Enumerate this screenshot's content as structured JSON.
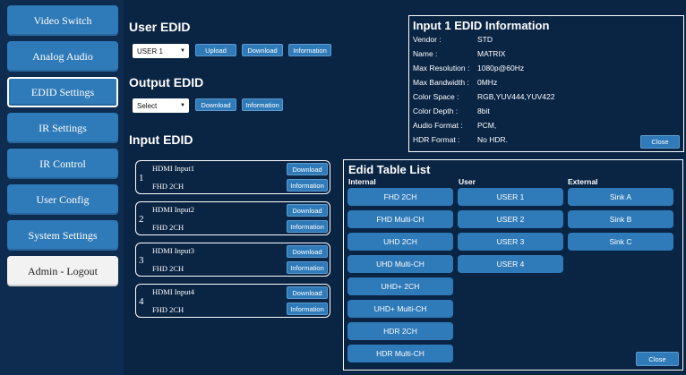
{
  "sidebar": {
    "items": [
      {
        "label": "Video Switch"
      },
      {
        "label": "Analog Audio"
      },
      {
        "label": "EDID Settings"
      },
      {
        "label": "IR Settings"
      },
      {
        "label": "IR Control"
      },
      {
        "label": "User Config"
      },
      {
        "label": "System Settings"
      },
      {
        "label": "Admin - Logout"
      }
    ]
  },
  "user_edid": {
    "title": "User EDID",
    "select_value": "USER 1",
    "upload_label": "Upload",
    "download_label": "Download",
    "information_label": "Information"
  },
  "output_edid": {
    "title": "Output EDID",
    "select_value": "Select",
    "download_label": "Download",
    "information_label": "Information"
  },
  "input_edid": {
    "title": "Input EDID",
    "inputs": [
      {
        "num": "1",
        "name": "HDMI Input1",
        "format": "FHD 2CH",
        "download_label": "Download",
        "information_label": "Information"
      },
      {
        "num": "2",
        "name": "HDMI Input2",
        "format": "FHD 2CH",
        "download_label": "Download",
        "information_label": "Information"
      },
      {
        "num": "3",
        "name": "HDMI Input3",
        "format": "FHD 2CH",
        "download_label": "Download",
        "information_label": "Information"
      },
      {
        "num": "4",
        "name": "HDMI Input4",
        "format": "FHD 2CH",
        "download_label": "Download",
        "information_label": "Information"
      }
    ]
  },
  "info_panel": {
    "title": "Input 1 EDID Information",
    "rows": [
      {
        "label": "Vendor :",
        "value": "STD"
      },
      {
        "label": "Name :",
        "value": "MATRIX"
      },
      {
        "label": "Max Resolution :",
        "value": "1080p@60Hz"
      },
      {
        "label": "Max Bandwidth :",
        "value": "0MHz"
      },
      {
        "label": "Color Space :",
        "value": "RGB,YUV444,YUV422"
      },
      {
        "label": "Color Depth :",
        "value": "8bit"
      },
      {
        "label": "Audio Format :",
        "value": "PCM,"
      },
      {
        "label": "HDR Format :",
        "value": "No HDR."
      }
    ],
    "close_label": "Close"
  },
  "edid_table": {
    "title": "Edid Table List",
    "columns": {
      "internal": {
        "header": "Internal",
        "items": [
          "FHD 2CH",
          "FHD Multi-CH",
          "UHD 2CH",
          "UHD Multi-CH",
          "UHD+ 2CH",
          "UHD+ Multi-CH",
          "HDR 2CH",
          "HDR Multi-CH"
        ]
      },
      "user": {
        "header": "User",
        "items": [
          "USER 1",
          "USER 2",
          "USER 3",
          "USER 4"
        ]
      },
      "external": {
        "header": "External",
        "items": [
          "Sink A",
          "Sink B",
          "Sink C"
        ]
      }
    },
    "close_label": "Close"
  },
  "colors": {
    "background": "#0a2444",
    "button": "#2f7ab8",
    "border": "#ffffff"
  }
}
